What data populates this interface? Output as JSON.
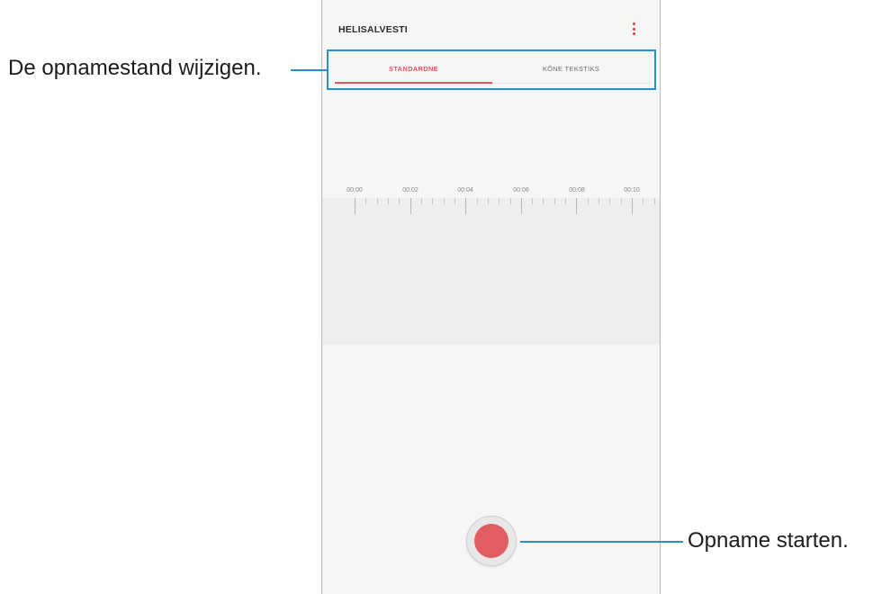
{
  "app": {
    "title": "HELISALVESTI",
    "more_icon": "more-vertical-icon",
    "accent_color": "#df5a5e"
  },
  "tabs": [
    {
      "label": "STANDARDNE",
      "selected": true
    },
    {
      "label": "KÕNE TEKSTIKS",
      "selected": false
    }
  ],
  "timeline": {
    "labels": [
      "00:00",
      "00:02",
      "00:04",
      "00:06",
      "00:08",
      "00:10"
    ]
  },
  "record": {
    "icon": "record-icon",
    "color": "#e05e61"
  },
  "annotations": {
    "mode_label": "De opnamestand wijzigen.",
    "record_label": "Opname starten.",
    "line_color": "#2a8fd0"
  }
}
